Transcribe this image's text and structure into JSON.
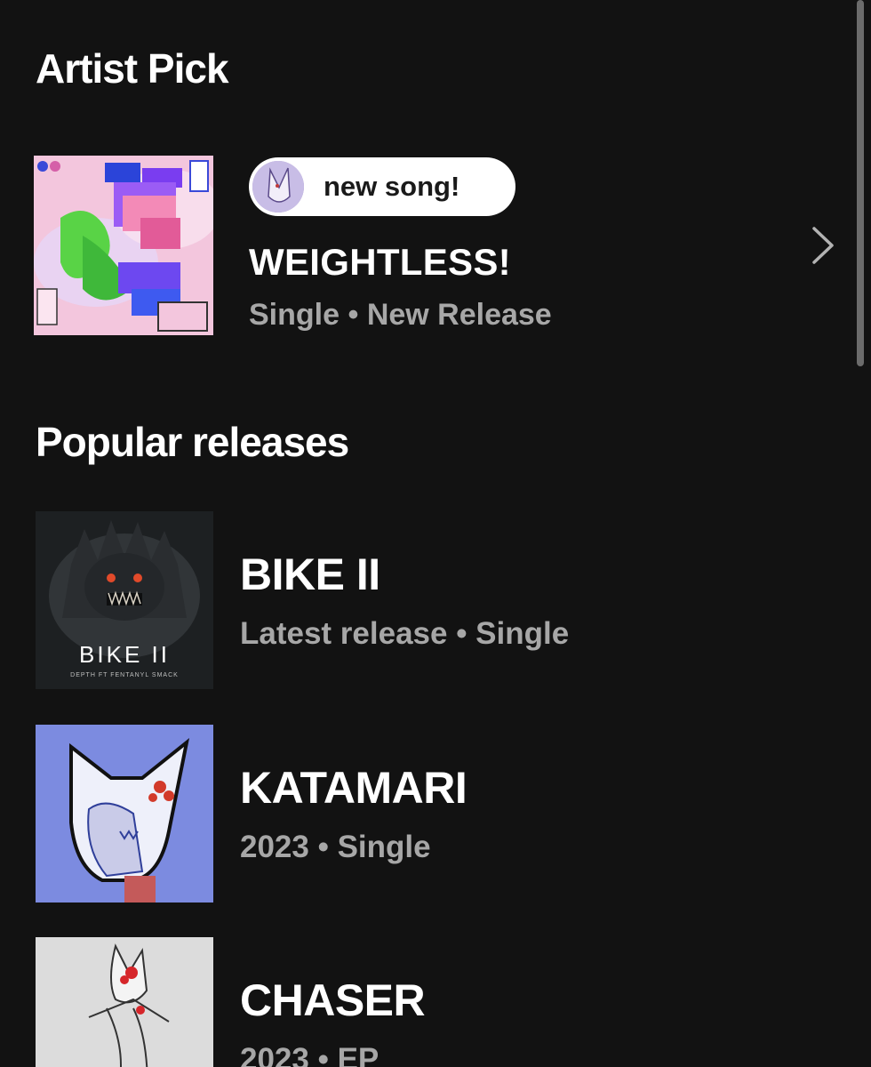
{
  "artist_pick": {
    "section_title": "Artist Pick",
    "badge_label": "new song!",
    "title": "WEIGHTLESS!",
    "subtitle": "Single • New Release"
  },
  "popular_releases": {
    "section_title": "Popular releases",
    "items": [
      {
        "title": "BIKE II",
        "subtitle": "Latest release • Single",
        "cover_text": "BIKE II",
        "cover_credit": "DEPTH FT FENTANYL SMACK"
      },
      {
        "title": "KATAMARI",
        "subtitle": "2023 • Single"
      },
      {
        "title": "CHASER",
        "subtitle": "2023 • EP"
      }
    ]
  },
  "colors": {
    "background": "#121212",
    "primary_text": "#ffffff",
    "secondary_text": "#a7a7a7",
    "pill_background": "#ffffff"
  },
  "icons": {
    "chevron": "chevron-right-icon"
  }
}
